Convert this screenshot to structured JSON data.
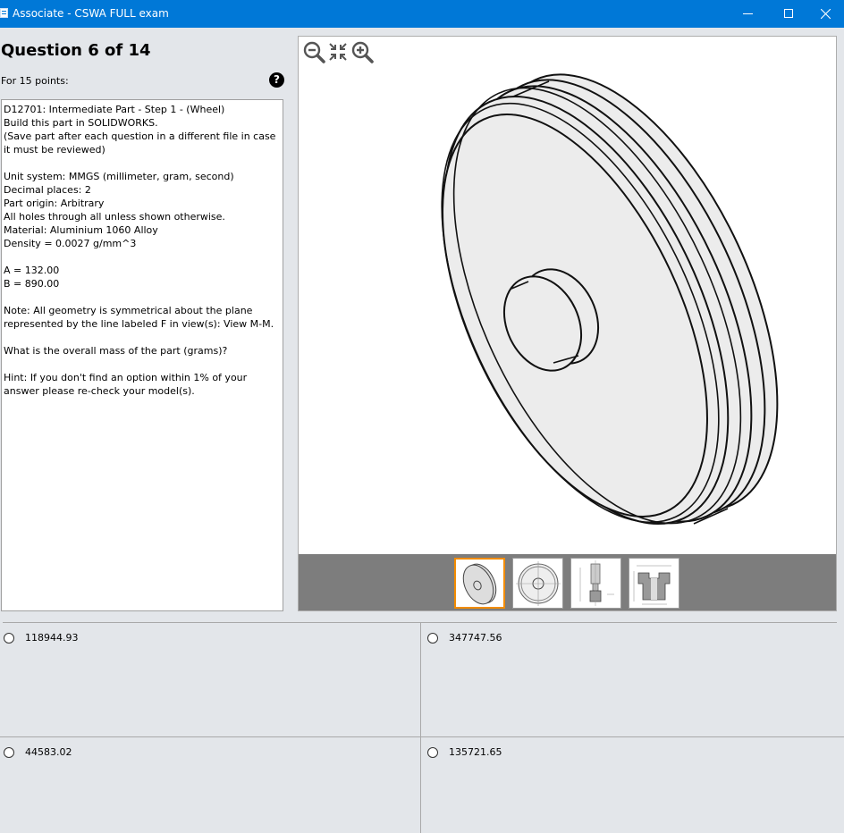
{
  "window": {
    "title": "Associate - CSWA FULL exam"
  },
  "question": {
    "heading": "Question 6 of 14",
    "points": "For 15 points:",
    "lines": [
      "D12701:  Intermediate Part - Step 1 - (Wheel)",
      "Build this part in SOLIDWORKS.",
      "(Save part after each question in a different file in case it must be reviewed)",
      "",
      "Unit system: MMGS (millimeter, gram, second)",
      "Decimal places: 2",
      "Part origin: Arbitrary",
      "All holes through all unless shown otherwise.",
      "Material: Aluminium 1060 Alloy",
      "Density = 0.0027 g/mm^3",
      "",
      "A = 132.00",
      "B = 890.00",
      "",
      "Note: All geometry is symmetrical about the plane represented by the line labeled F in view(s):  View M-M.",
      "",
      "What is the overall mass of the part (grams)?",
      "",
      "Hint: If you don't find an option within 1% of your answer please re-check your model(s)."
    ]
  },
  "viewer": {
    "tools": [
      "zoom-out-icon",
      "fit-view-icon",
      "zoom-in-icon"
    ],
    "thumbnails": [
      "isometric-view",
      "front-view",
      "section-view-1",
      "section-view-2"
    ],
    "selected_thumbnail": 0
  },
  "answers": {
    "options": [
      "118944.93",
      "347747.56",
      "44583.02",
      "135721.65"
    ]
  },
  "colors": {
    "titlebar": "#0078d7",
    "selection": "#f28c00",
    "panel": "#e3e6ea"
  }
}
